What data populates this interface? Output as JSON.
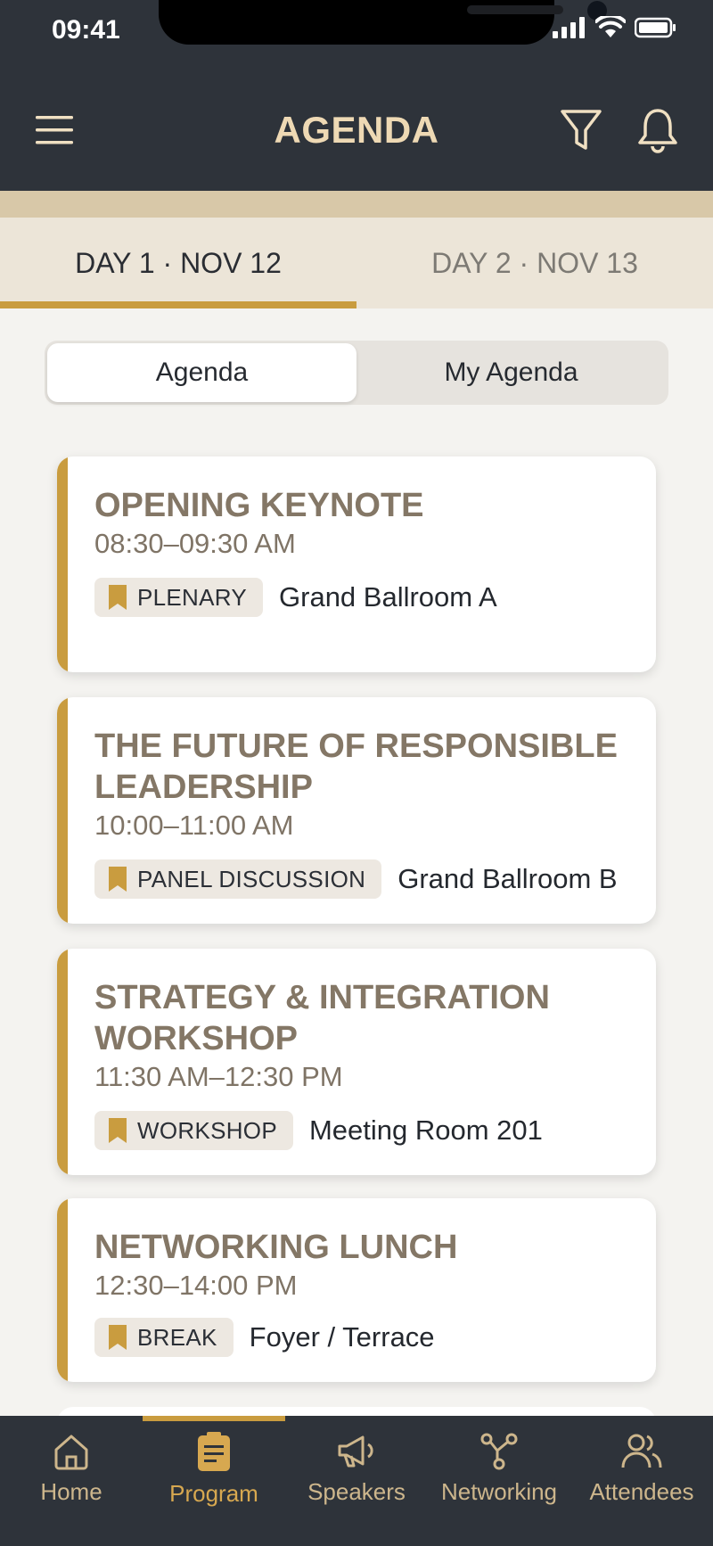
{
  "status": {
    "time": "09:41"
  },
  "header": {
    "title": "AGENDA"
  },
  "day_tabs": [
    {
      "label": "DAY 1 · NOV 12",
      "active": true
    },
    {
      "label": "DAY 2 · NOV 13",
      "active": false
    }
  ],
  "segmented": {
    "options": [
      "Agenda",
      "My Agenda"
    ],
    "selected": "Agenda"
  },
  "sessions": [
    {
      "title": "OPENING KEYNOTE",
      "time": "08:30–09:30 AM",
      "tag": "PLENARY",
      "room": "Grand Ballroom A"
    },
    {
      "title": "THE FUTURE OF RESPONSIBLE LEADERSHIP",
      "time": "10:00–11:00 AM",
      "tag": "PANEL DISCUSSION",
      "room": "Grand Ballroom B"
    },
    {
      "title": "STRATEGY & INTEGRATION WORKSHOP",
      "time": "11:30 AM–12:30 PM",
      "tag": "WORKSHOP",
      "room": "Meeting Room 201"
    },
    {
      "title": "NETWORKING LUNCH",
      "time": "12:30–14:00 PM",
      "tag": "BREAK",
      "room": "Foyer / Terrace"
    }
  ],
  "nav": {
    "items": [
      {
        "label": "Home",
        "icon": "home-icon"
      },
      {
        "label": "Program",
        "icon": "clipboard-icon",
        "active": true
      },
      {
        "label": "Speakers",
        "icon": "megaphone-icon"
      },
      {
        "label": "Networking",
        "icon": "network-icon"
      },
      {
        "label": "Attendees",
        "icon": "people-icon"
      }
    ]
  },
  "colors": {
    "header": "#2e333a",
    "accent": "#c99c3f",
    "title": "#eed9b4",
    "card_title": "#847766"
  }
}
